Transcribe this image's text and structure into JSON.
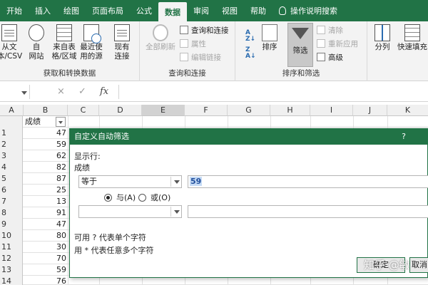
{
  "tabs": [
    {
      "label": "开始"
    },
    {
      "label": "插入"
    },
    {
      "label": "绘图"
    },
    {
      "label": "页面布局"
    },
    {
      "label": "公式"
    },
    {
      "label": "数据",
      "active": true
    },
    {
      "label": "审阅"
    },
    {
      "label": "视图"
    },
    {
      "label": "帮助"
    },
    {
      "label": "操作说明搜索"
    }
  ],
  "ribbon": {
    "get_data": {
      "label": "获取和转换数据",
      "from_text": [
        "从文",
        "本/CSV"
      ],
      "from_web": [
        "自",
        "网站"
      ],
      "from_table": [
        "来自表",
        "格/区域"
      ],
      "recent": [
        "最近使",
        "用的源"
      ],
      "existing": [
        "现有",
        "连接"
      ]
    },
    "queries": {
      "label": "查询和连接",
      "refresh_all": "全部刷新",
      "queries_connections": "查询和连接",
      "properties": "属性",
      "edit_links": "编辑链接"
    },
    "sort_filter": {
      "label": "排序和筛选",
      "sort": "排序",
      "filter": "筛选",
      "clear": "清除",
      "reapply": "重新应用",
      "advanced": "高级"
    },
    "tools": {
      "split": "分列",
      "flash_fill": "快速填充"
    }
  },
  "formula_bar": {
    "cancel": "×",
    "enter": "✓",
    "fx": "fx"
  },
  "grid": {
    "columns": [
      "A",
      "B",
      "C",
      "D",
      "E",
      "F",
      "G",
      "H",
      "I",
      "J",
      "K"
    ],
    "header_cell": "成绩",
    "rows": [
      {
        "num": "1",
        "value": "47"
      },
      {
        "num": "2",
        "value": "59"
      },
      {
        "num": "3",
        "value": "62"
      },
      {
        "num": "4",
        "value": "82"
      },
      {
        "num": "5",
        "value": "87"
      },
      {
        "num": "6",
        "value": "25"
      },
      {
        "num": "7",
        "value": "13"
      },
      {
        "num": "8",
        "value": "91"
      },
      {
        "num": "9",
        "value": "47"
      },
      {
        "num": "10",
        "value": "80"
      },
      {
        "num": "11",
        "value": "30"
      },
      {
        "num": "12",
        "value": "70"
      },
      {
        "num": "13",
        "value": "59"
      },
      {
        "num": "14",
        "value": "76"
      }
    ]
  },
  "dialog": {
    "title": "自定义自动筛选",
    "help": "?",
    "show_rows": "显示行:",
    "field": "成绩",
    "operator1": "等于",
    "value1": "59",
    "and_label": "与(A)",
    "or_label": "或(O)",
    "hint1": "可用 ? 代表单个字符",
    "hint2": "用 * 代表任意多个字符",
    "ok": "确定",
    "cancel": "取消"
  },
  "watermark": "知乎 @敏"
}
